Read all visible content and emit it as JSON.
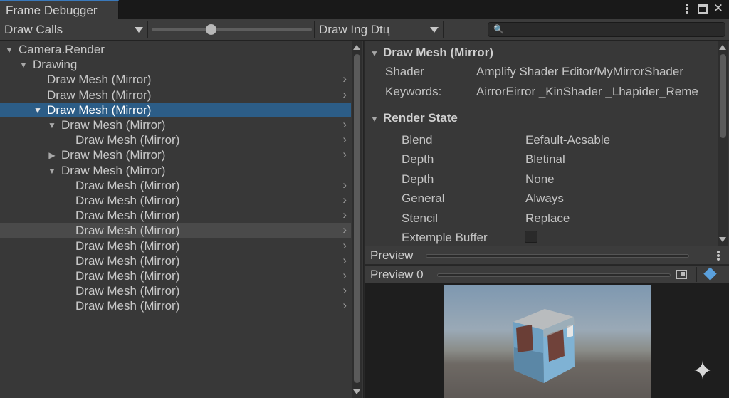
{
  "window": {
    "tab_title": "Frame Debugger"
  },
  "toolbar": {
    "mode_dropdown": "Draw Calls",
    "slider_value": 0.37,
    "filter_dropdown": "Draw Ing Dtц",
    "search_placeholder": "",
    "search_icon": "search-icon"
  },
  "tree": {
    "items": [
      {
        "label": "Camera.Render",
        "depth": 0,
        "expander": "expanded",
        "chevron": false,
        "state": "normal"
      },
      {
        "label": "Drawing",
        "depth": 1,
        "expander": "expanded",
        "chevron": false,
        "state": "normal"
      },
      {
        "label": "Draw Mesh (Mirror)",
        "depth": 2,
        "expander": "none",
        "chevron": true,
        "state": "normal"
      },
      {
        "label": "Draw Mesh (Mirror)",
        "depth": 2,
        "expander": "none",
        "chevron": true,
        "state": "normal"
      },
      {
        "label": "Draw Mesh (Mirror)",
        "depth": 2,
        "expander": "expanded",
        "chevron": false,
        "state": "selected"
      },
      {
        "label": "Draw Mesh (Mirror)",
        "depth": 3,
        "expander": "expanded",
        "chevron": true,
        "state": "normal"
      },
      {
        "label": "Draw Mesh (Mirror)",
        "depth": 4,
        "expander": "none",
        "chevron": true,
        "state": "normal"
      },
      {
        "label": "Draw Mesh (Mirror)",
        "depth": 3,
        "expander": "collapsed",
        "chevron": true,
        "state": "normal"
      },
      {
        "label": "Draw Mesh (Mirror)",
        "depth": 3,
        "expander": "expanded",
        "chevron": false,
        "state": "normal"
      },
      {
        "label": "Draw Mesh (Mirror)",
        "depth": 4,
        "expander": "none",
        "chevron": true,
        "state": "normal"
      },
      {
        "label": "Draw Mesh (Mirror)",
        "depth": 4,
        "expander": "none",
        "chevron": true,
        "state": "normal"
      },
      {
        "label": "Draw Mesh (Mirror)",
        "depth": 4,
        "expander": "none",
        "chevron": true,
        "state": "normal"
      },
      {
        "label": "Draw Mesh (Mirror)",
        "depth": 4,
        "expander": "none",
        "chevron": true,
        "state": "hovered"
      },
      {
        "label": "Draw Mesh (Mirror)",
        "depth": 4,
        "expander": "none",
        "chevron": true,
        "state": "normal"
      },
      {
        "label": "Draw Mesh (Mirror)",
        "depth": 4,
        "expander": "none",
        "chevron": true,
        "state": "normal"
      },
      {
        "label": "Draw Mesh (Mirror)",
        "depth": 4,
        "expander": "none",
        "chevron": true,
        "state": "normal"
      },
      {
        "label": "Draw Mesh (Mirror)",
        "depth": 4,
        "expander": "none",
        "chevron": true,
        "state": "normal"
      },
      {
        "label": "Draw Mesh (Mirror)",
        "depth": 4,
        "expander": "none",
        "chevron": true,
        "state": "normal"
      }
    ]
  },
  "details": {
    "title": "Draw Mesh (Mirror)",
    "shader_label": "Shader",
    "shader_value": "Amplify Shader Editor/MyMirrorShader",
    "keywords_label": "Keywords:",
    "keywords_value": "AirrorEirror _KinShader _Lhapider_Reme",
    "render_state": {
      "title": "Render State",
      "rows": [
        {
          "key": "Blend",
          "value": "Eefault-Acsable"
        },
        {
          "key": "Depth",
          "value": "Bletinal"
        },
        {
          "key": "Depth",
          "value": "None"
        },
        {
          "key": "General",
          "value": "Always"
        },
        {
          "key": "Stencil",
          "value": "Replace"
        }
      ],
      "checkbox_row": {
        "key": "Extemple Buffer",
        "checked": false
      }
    }
  },
  "preview": {
    "header_label": "Preview",
    "sub_label": "Preview 0",
    "icons": [
      "kebab-menu-icon",
      "window-icon",
      "shape-diamond-icon",
      "sparkle-icon"
    ]
  },
  "colors": {
    "selection": "#2c5d87",
    "accent": "#3a79bb",
    "panel": "#383838"
  }
}
